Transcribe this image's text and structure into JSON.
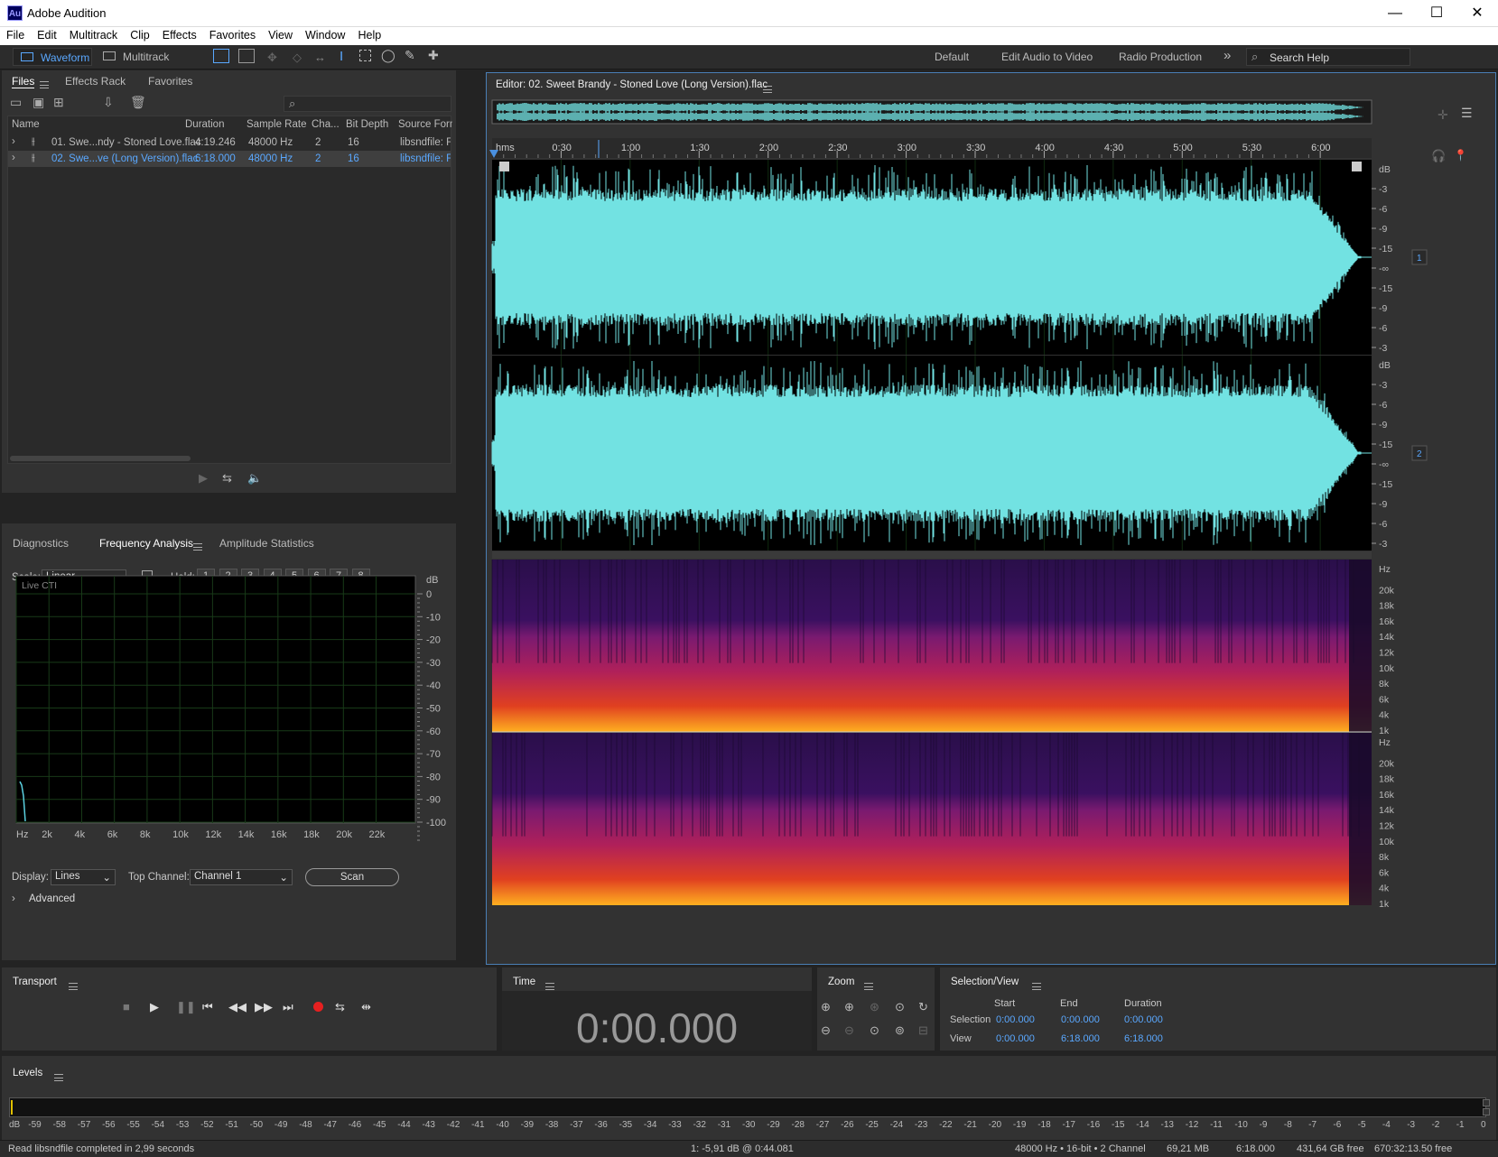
{
  "app": {
    "logo": "Au",
    "title": "Adobe Audition"
  },
  "window_controls": {
    "minimize": "—",
    "maximize": "☐",
    "close": "✕"
  },
  "menu": [
    "File",
    "Edit",
    "Multitrack",
    "Clip",
    "Effects",
    "Favorites",
    "View",
    "Window",
    "Help"
  ],
  "toolbar": {
    "waveform": "Waveform",
    "multitrack": "Multitrack",
    "workspaces": [
      "Default",
      "Edit Audio to Video",
      "Radio Production"
    ],
    "more": "»",
    "search": "Search Help"
  },
  "files_panel": {
    "tabs": [
      "Files",
      "Effects Rack",
      "Favorites"
    ],
    "columns": [
      "Name",
      "Duration",
      "Sample Rate",
      "Cha...",
      "Bit Depth",
      "Source Form"
    ],
    "rows": [
      {
        "name": "01. Swe...ndy - Stoned Love.flac",
        "duration": "4:19.246",
        "rate": "48000 Hz",
        "ch": "2",
        "bits": "16",
        "source": "libsndfile: FL"
      },
      {
        "name": "02. Swe...ve (Long Version).flac",
        "duration": "6:18.000",
        "rate": "48000 Hz",
        "ch": "2",
        "bits": "16",
        "source": "libsndfile: FL"
      }
    ]
  },
  "analysis_panel": {
    "tabs": [
      "Diagnostics",
      "Frequency Analysis",
      "Amplitude Statistics"
    ],
    "scale_label": "Scale:",
    "scale_value": "Linear",
    "hold_label": "Hold:",
    "hold": [
      "1",
      "2",
      "3",
      "4",
      "5",
      "6",
      "7",
      "8"
    ],
    "hold_colors": [
      "#e02020",
      "#ff8c00",
      "#f0e000",
      "#7fd000",
      "#20c040",
      "#20d0d0",
      "#3080ff",
      "#e020e0"
    ],
    "live_cti": "Live CTI",
    "db_unit": "dB",
    "db_ticks": [
      "0",
      "-10",
      "-20",
      "-30",
      "-40",
      "-50",
      "-60",
      "-70",
      "-80",
      "-90",
      "-100"
    ],
    "hz_ticks": [
      "Hz",
      "2k",
      "4k",
      "6k",
      "8k",
      "10k",
      "12k",
      "14k",
      "16k",
      "18k",
      "20k",
      "22k"
    ],
    "display_label": "Display:",
    "display_value": "Lines",
    "top_channel_label": "Top Channel:",
    "top_channel_value": "Channel 1",
    "scan": "Scan",
    "advanced": "Advanced"
  },
  "editor": {
    "title": "Editor: 02. Sweet Brandy - Stoned Love (Long Version).flac",
    "ruler": [
      "hms",
      "0:30",
      "1:00",
      "1:30",
      "2:00",
      "2:30",
      "3:00",
      "3:30",
      "4:00",
      "4:30",
      "5:00",
      "5:30",
      "6:00"
    ],
    "db_labels": [
      "dB",
      "-3",
      "-6",
      "-9",
      "-15",
      "-∞",
      "-15",
      "-9",
      "-6",
      "-3"
    ],
    "channels": [
      "1",
      "2"
    ],
    "hz_labels": [
      "Hz",
      "20k",
      "18k",
      "16k",
      "14k",
      "12k",
      "10k",
      "8k",
      "6k",
      "4k",
      "1k"
    ],
    "wave_color": "#72e2e2"
  },
  "transport": {
    "title": "Transport"
  },
  "time": {
    "title": "Time",
    "value": "0:00.000"
  },
  "zoom": {
    "title": "Zoom"
  },
  "selection": {
    "title": "Selection/View",
    "cols": [
      "Start",
      "End",
      "Duration"
    ],
    "rows": [
      {
        "label": "Selection",
        "start": "0:00.000",
        "end": "0:00.000",
        "dur": "0:00.000"
      },
      {
        "label": "View",
        "start": "0:00.000",
        "end": "6:18.000",
        "dur": "6:18.000"
      }
    ]
  },
  "levels": {
    "title": "Levels",
    "ticks": [
      "dB",
      "-59",
      "-58",
      "-57",
      "-56",
      "-55",
      "-54",
      "-53",
      "-52",
      "-51",
      "-50",
      "-49",
      "-48",
      "-47",
      "-46",
      "-45",
      "-44",
      "-43",
      "-42",
      "-41",
      "-40",
      "-39",
      "-38",
      "-37",
      "-36",
      "-35",
      "-34",
      "-33",
      "-32",
      "-31",
      "-30",
      "-29",
      "-28",
      "-27",
      "-26",
      "-25",
      "-24",
      "-23",
      "-22",
      "-21",
      "-20",
      "-19",
      "-18",
      "-17",
      "-16",
      "-15",
      "-14",
      "-13",
      "-12",
      "-11",
      "-10",
      "-9",
      "-8",
      "-7",
      "-6",
      "-5",
      "-4",
      "-3",
      "-2",
      "-1",
      "0"
    ]
  },
  "status": {
    "left": "Read libsndfile completed in 2,99 seconds",
    "cursor": "1: -5,91 dB @ 0:44.081",
    "format": "48000 Hz • 16-bit • 2 Channel",
    "size": "69,21 MB",
    "duration": "6:18.000",
    "free": "431,64 GB free",
    "free_time": "670:32:13.50 free"
  }
}
